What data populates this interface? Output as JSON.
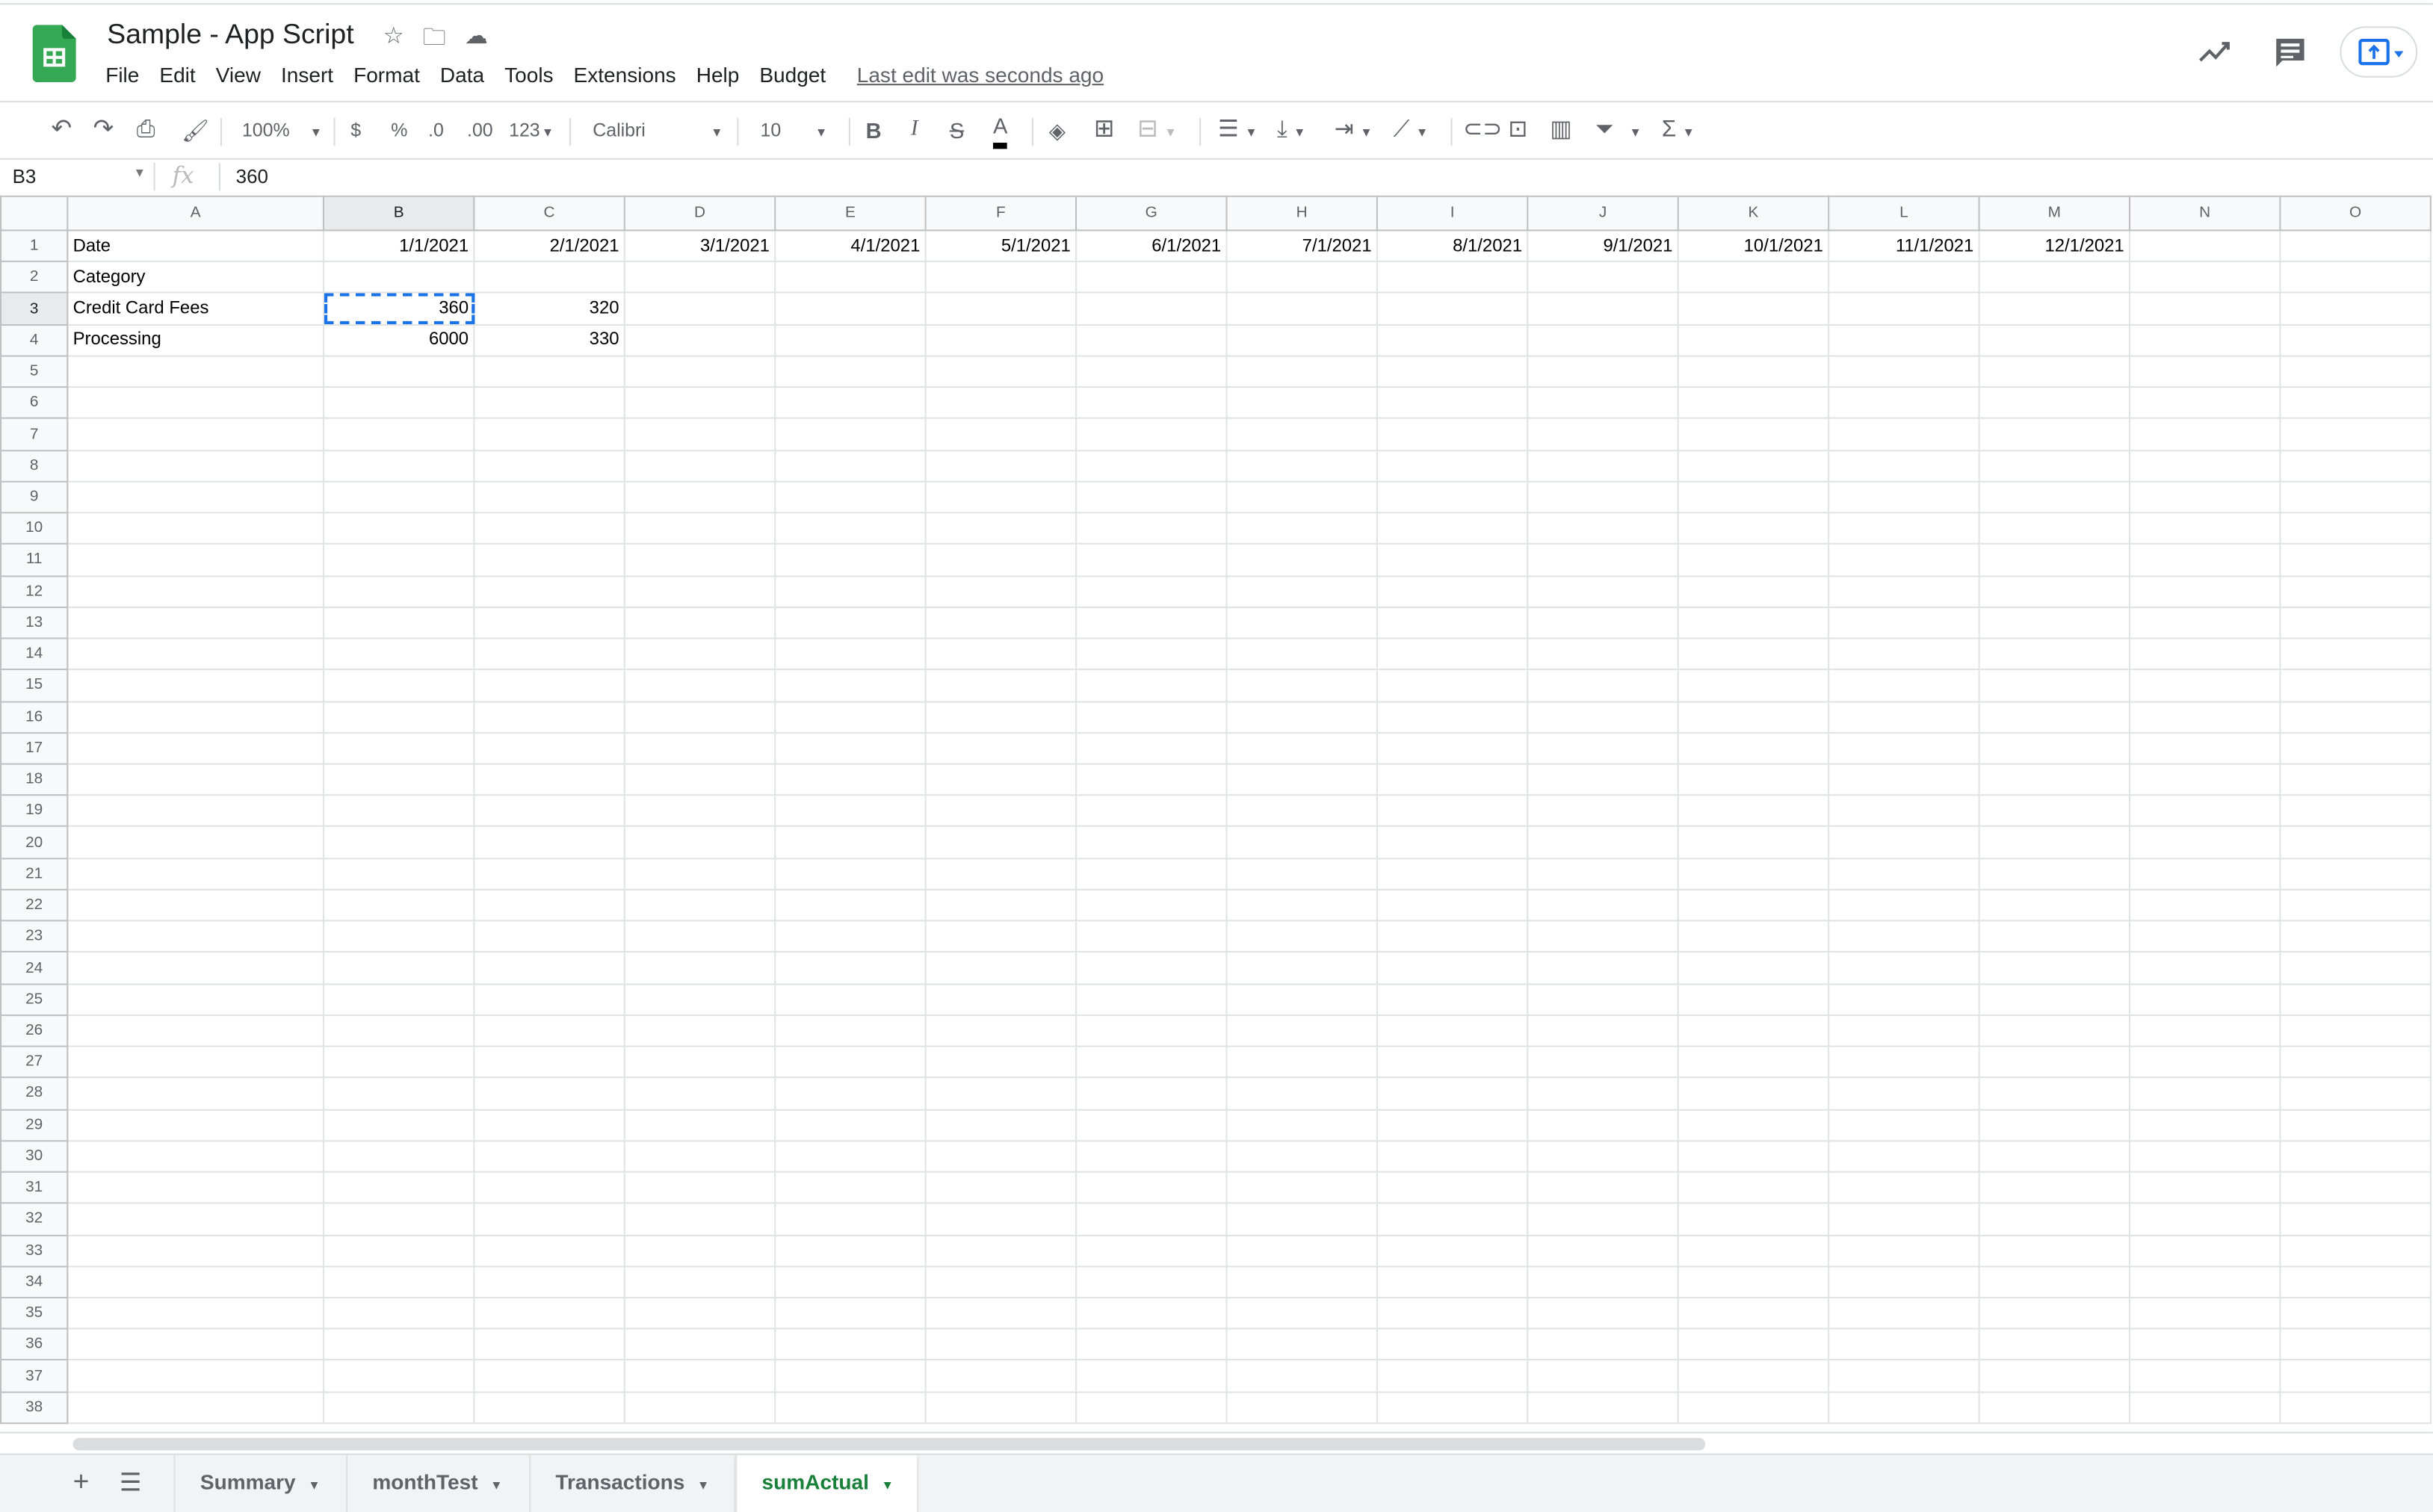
{
  "doc": {
    "title": "Sample - App Script",
    "last_edit": "Last edit was seconds ago"
  },
  "menu": [
    "File",
    "Edit",
    "View",
    "Insert",
    "Format",
    "Data",
    "Tools",
    "Extensions",
    "Help",
    "Budget"
  ],
  "toolbar": {
    "zoom": "100%",
    "currency": "$",
    "percent": "%",
    "dec_less": ".0",
    "dec_more": ".00",
    "format_more": "123",
    "font": "Calibri",
    "font_size": "10",
    "bold": "B",
    "italic": "I",
    "strike": "S",
    "text_color": "A",
    "sum": "Σ"
  },
  "formula_bar": {
    "name_box": "B3",
    "fx": "fx",
    "value": "360"
  },
  "grid": {
    "columns": [
      "A",
      "B",
      "C",
      "D",
      "E",
      "F",
      "G",
      "H",
      "I",
      "J",
      "K",
      "L",
      "M",
      "N",
      "O"
    ],
    "row_count": 38,
    "selected": {
      "col": "B",
      "row": 3
    },
    "rows": [
      [
        "Date",
        "1/1/2021",
        "2/1/2021",
        "3/1/2021",
        "4/1/2021",
        "5/1/2021",
        "6/1/2021",
        "7/1/2021",
        "8/1/2021",
        "9/1/2021",
        "10/1/2021",
        "11/1/2021",
        "12/1/2021",
        "",
        ""
      ],
      [
        "Category",
        "",
        "",
        "",
        "",
        "",
        "",
        "",
        "",
        "",
        "",
        "",
        "",
        "",
        ""
      ],
      [
        "Credit Card Fees",
        "360",
        "320",
        "",
        "",
        "",
        "",
        "",
        "",
        "",
        "",
        "",
        "",
        "",
        ""
      ],
      [
        "Processing",
        "6000",
        "330",
        "",
        "",
        "",
        "",
        "",
        "",
        "",
        "",
        "",
        "",
        "",
        ""
      ]
    ]
  },
  "tabs": [
    {
      "label": "Summary"
    },
    {
      "label": "monthTest"
    },
    {
      "label": "Transactions"
    },
    {
      "label": "sumActual",
      "active": true
    }
  ],
  "colors": {
    "accent": "#1a73e8",
    "active_tab": "#188038",
    "logo": "#34a853"
  }
}
